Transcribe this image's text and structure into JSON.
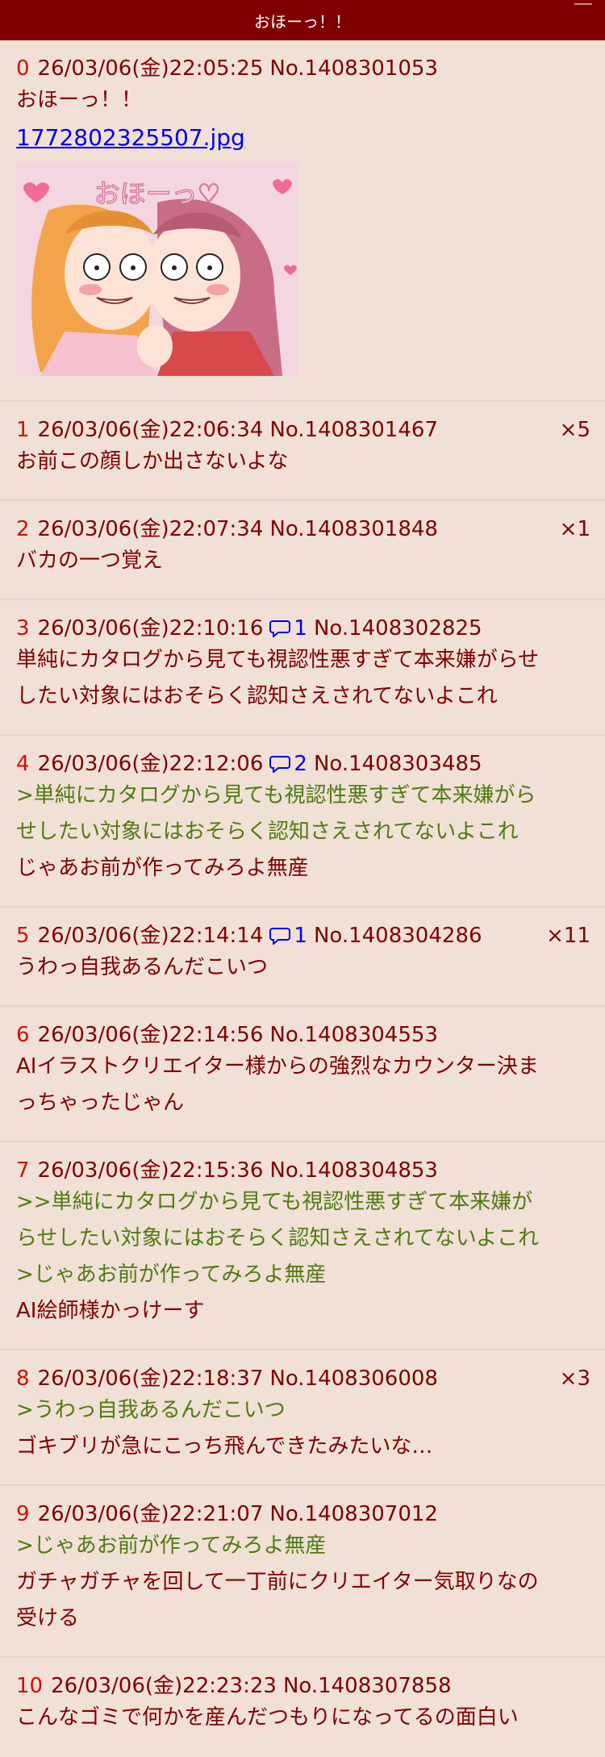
{
  "app": {
    "title": "おほーっ！！"
  },
  "op": {
    "num": "0",
    "date": "26/03/06(金)22:05:25",
    "no": "No.1408301053",
    "lines": [
      {
        "text": "おほーっ！！",
        "type": "plain"
      }
    ],
    "file": "1772802325507.jpg",
    "thumb_text": "おほーっ♡"
  },
  "posts": [
    {
      "num": "1",
      "date": "26/03/06(金)22:06:34",
      "no": "No.1408301467",
      "count": "×5",
      "lines": [
        {
          "text": "お前この顔しか出さないよな",
          "type": "plain"
        }
      ]
    },
    {
      "num": "2",
      "date": "26/03/06(金)22:07:34",
      "no": "No.1408301848",
      "count": "×1",
      "lines": [
        {
          "text": "バカの一つ覚え",
          "type": "plain"
        }
      ]
    },
    {
      "num": "3",
      "date": "26/03/06(金)22:10:16",
      "replies": "1",
      "no": "No.1408302825",
      "lines": [
        {
          "text": "単純にカタログから見ても視認性悪すぎて本来嫌がらせ",
          "type": "plain"
        },
        {
          "text": "したい対象にはおそらく認知さえされてないよこれ",
          "type": "plain"
        }
      ]
    },
    {
      "num": "4",
      "date": "26/03/06(金)22:12:06",
      "replies": "2",
      "no": "No.1408303485",
      "lines": [
        {
          "text": ">単純にカタログから見ても視認性悪すぎて本来嫌がら",
          "type": "quote"
        },
        {
          "text": "せしたい対象にはおそらく認知さえされてないよこれ",
          "type": "quote"
        },
        {
          "text": "じゃあお前が作ってみろよ無産",
          "type": "plain"
        }
      ]
    },
    {
      "num": "5",
      "date": "26/03/06(金)22:14:14",
      "replies": "1",
      "no": "No.1408304286",
      "count": "×11",
      "lines": [
        {
          "text": "うわっ自我あるんだこいつ",
          "type": "plain"
        }
      ]
    },
    {
      "num": "6",
      "date": "26/03/06(金)22:14:56",
      "no": "No.1408304553",
      "lines": [
        {
          "text": "AIイラストクリエイター様からの強烈なカウンター決ま",
          "type": "plain"
        },
        {
          "text": "っちゃったじゃん",
          "type": "plain"
        }
      ]
    },
    {
      "num": "7",
      "date": "26/03/06(金)22:15:36",
      "no": "No.1408304853",
      "lines": [
        {
          "text": ">>単純にカタログから見ても視認性悪すぎて本来嫌が",
          "type": "quote"
        },
        {
          "text": "らせしたい対象にはおそらく認知さえされてないよこれ",
          "type": "quote"
        },
        {
          "text": ">じゃあお前が作ってみろよ無産",
          "type": "quote"
        },
        {
          "text": "AI絵師様かっけーす",
          "type": "plain"
        }
      ]
    },
    {
      "num": "8",
      "date": "26/03/06(金)22:18:37",
      "no": "No.1408306008",
      "count": "×3",
      "lines": [
        {
          "text": ">うわっ自我あるんだこいつ",
          "type": "quote"
        },
        {
          "text": "ゴキブリが急にこっち飛んできたみたいな…",
          "type": "plain"
        }
      ]
    },
    {
      "num": "9",
      "date": "26/03/06(金)22:21:07",
      "no": "No.1408307012",
      "lines": [
        {
          "text": ">じゃあお前が作ってみろよ無産",
          "type": "quote"
        },
        {
          "text": "ガチャガチャを回して一丁前にクリエイター気取りなの",
          "type": "plain"
        },
        {
          "text": "受ける",
          "type": "plain"
        }
      ]
    },
    {
      "num": "10",
      "date": "26/03/06(金)22:23:23",
      "no": "No.1408307858",
      "lines": [
        {
          "text": "こんなゴミで何かを産んだつもりになってるの面白い",
          "type": "plain"
        }
      ]
    }
  ]
}
